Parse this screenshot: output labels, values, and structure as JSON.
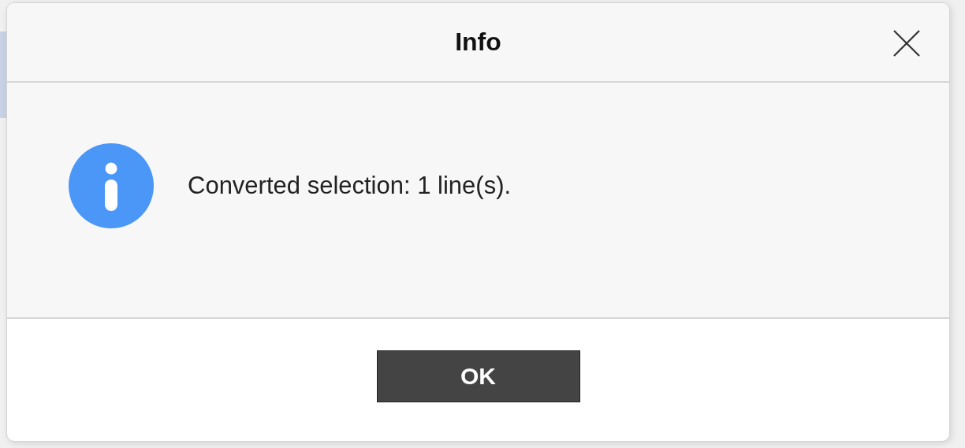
{
  "dialog": {
    "title": "Info",
    "message": "Converted selection: 1 line(s).",
    "buttons": [
      "OK"
    ]
  }
}
